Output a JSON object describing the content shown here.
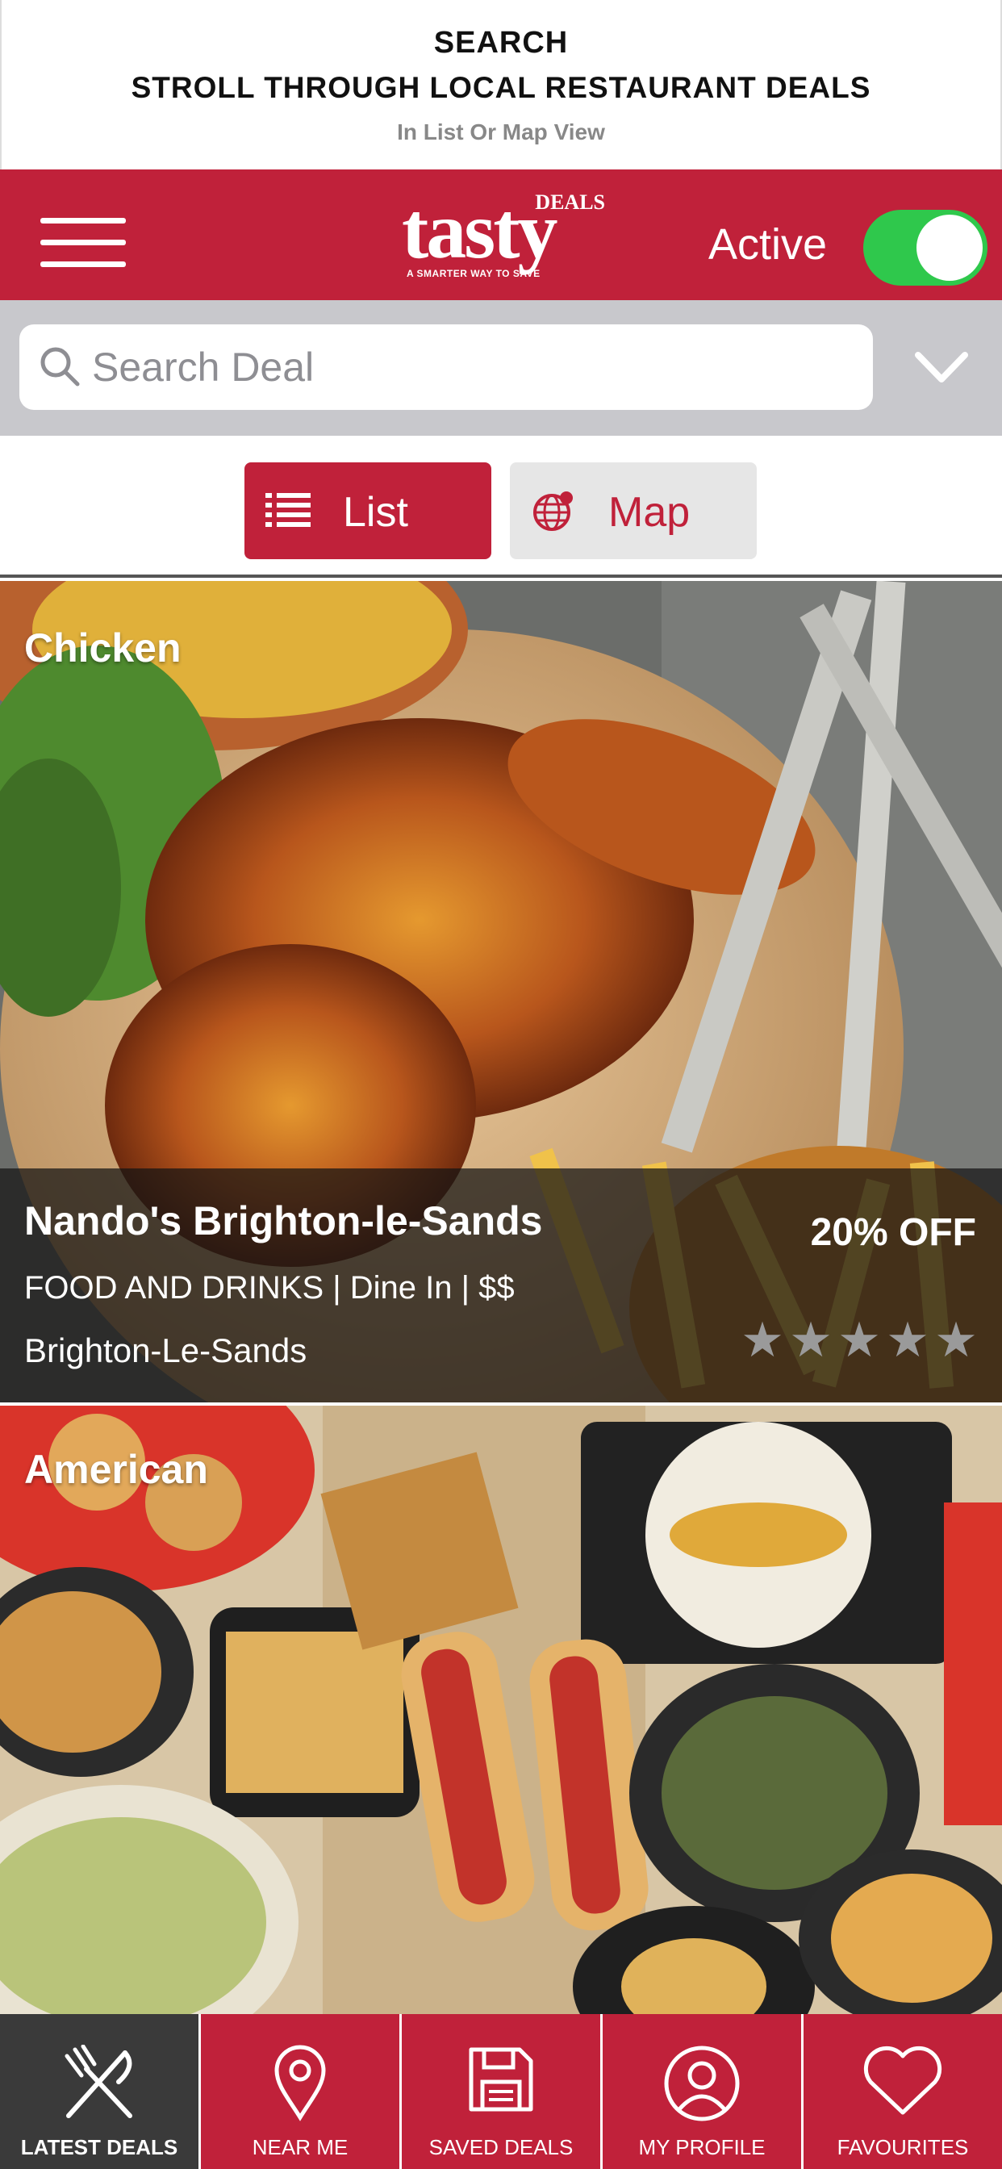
{
  "promo": {
    "line1": "SEARCH",
    "line2": "STROLL THROUGH LOCAL RESTAURANT DEALS",
    "line3": "In List Or Map View"
  },
  "header": {
    "logo_word": "tasty",
    "logo_deals": "DEALS",
    "logo_tagline": "A SMARTER WAY TO SAVE",
    "active_label": "Active",
    "active_on": true,
    "brand_color": "#c0213a",
    "toggle_color": "#2fc84c"
  },
  "search": {
    "placeholder": "Search Deal",
    "value": ""
  },
  "view_toggle": {
    "list_label": "List",
    "map_label": "Map",
    "selected": "List"
  },
  "deals": [
    {
      "category": "Chicken",
      "name": "Nando's Brighton-le-Sands",
      "meta": "FOOD AND DRINKS | Dine In | $$",
      "location": "Brighton-Le-Sands",
      "discount": "20% OFF",
      "rating": 0
    },
    {
      "category": "American"
    }
  ],
  "nav": {
    "items": [
      {
        "label": "LATEST DEALS",
        "icon": "fork-knife-icon",
        "active": true
      },
      {
        "label": "NEAR ME",
        "icon": "location-pin-icon",
        "active": false
      },
      {
        "label": "SAVED DEALS",
        "icon": "floppy-disk-icon",
        "active": false
      },
      {
        "label": "MY PROFILE",
        "icon": "user-circle-icon",
        "active": false
      },
      {
        "label": "FAVOURITES",
        "icon": "heart-icon",
        "active": false
      }
    ]
  }
}
